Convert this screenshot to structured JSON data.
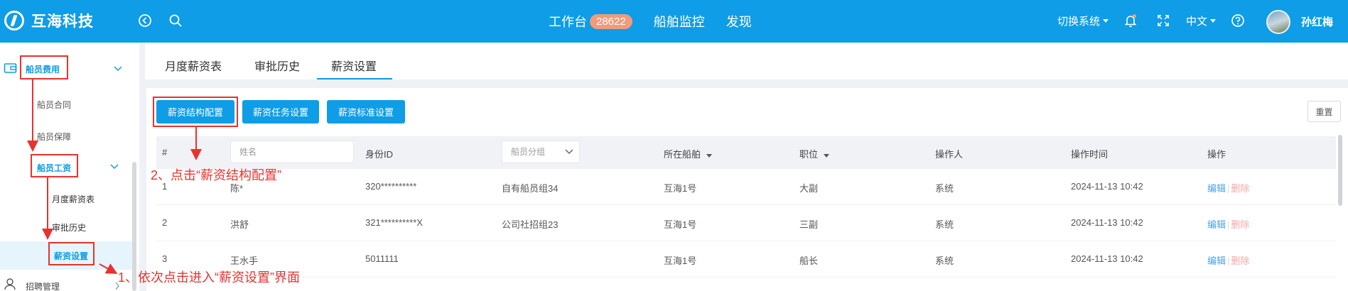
{
  "header": {
    "app_name": "互海科技",
    "nav": [
      {
        "label": "工作台",
        "badge": "28622"
      },
      {
        "label": "船舶监控"
      },
      {
        "label": "发现"
      }
    ],
    "switch_system": "切换系统",
    "language": "中文",
    "user_name": "孙红梅",
    "icons": [
      "back-icon",
      "search-icon",
      "bell-icon",
      "fullscreen-icon",
      "help-icon"
    ]
  },
  "sidebar": {
    "groups": [
      {
        "label": "船员费用",
        "items": [
          "船员合同",
          "船员保障"
        ]
      },
      {
        "label": "船员工资",
        "items": [
          "月度薪资表",
          "审批历史",
          "薪资设置"
        ]
      }
    ],
    "next_group": "招聘管理"
  },
  "tabs": [
    "月度薪资表",
    "审批历史",
    "薪资设置"
  ],
  "toolbar": {
    "buttons": [
      "薪资结构配置",
      "薪资任务设置",
      "薪资标准设置"
    ],
    "reset": "重置"
  },
  "table": {
    "columns": {
      "index": "#",
      "name_placeholder": "姓名",
      "id": "身份ID",
      "group_placeholder": "船员分组",
      "ship": "所在船舶",
      "position": "职位",
      "operator": "操作人",
      "time": "操作时间",
      "action": "操作"
    },
    "rows": [
      {
        "index": "1",
        "name": "陈*",
        "id": "320**********",
        "group": "自有船员组34",
        "ship": "互海1号",
        "position": "大副",
        "operator": "系统",
        "time": "2024-11-13 10:42"
      },
      {
        "index": "2",
        "name": "洪舒",
        "id": "321**********X",
        "group": "公司社招组23",
        "ship": "互海1号",
        "position": "三副",
        "operator": "系统",
        "time": "2024-11-13 10:42"
      },
      {
        "index": "3",
        "name": "王水手",
        "id": "5011111",
        "group": "",
        "ship": "互海1号",
        "position": "船长",
        "operator": "系统",
        "time": "2024-11-13 10:42"
      }
    ],
    "actions": {
      "edit": "编辑",
      "delete": "删除"
    }
  },
  "annotations": {
    "step1": "1、依次点击进入“薪资设置”界面",
    "step2": "2、点击“薪资结构配置”"
  },
  "colors": {
    "brand": "#0e9de6",
    "annotation": "#e6332f",
    "badge": "#f29a7a"
  }
}
